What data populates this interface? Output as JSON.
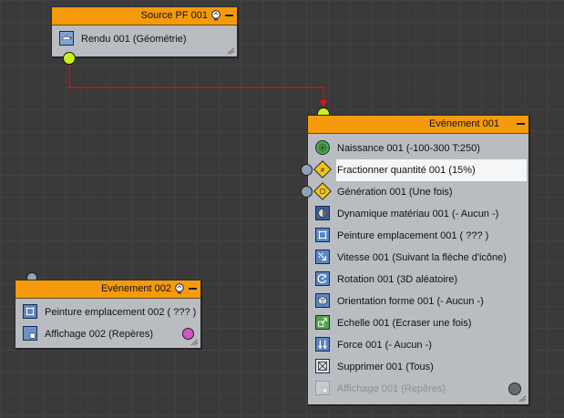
{
  "source_node": {
    "title": "Source PF 001",
    "items": [
      {
        "label": "Rendu 001 (Géométrie)",
        "icon": "teapot-icon"
      }
    ]
  },
  "event_002": {
    "title": "Evénement 002",
    "items": [
      {
        "label": "Peinture emplacement 002 ( ??? )",
        "icon": "position-icon"
      },
      {
        "label": "Affichage 002 (Repères)",
        "icon": "display-icon"
      }
    ]
  },
  "event_001": {
    "title": "Evénement 001",
    "items": [
      {
        "label": "Naissance 001 (-100-300 T:250)",
        "icon": "birth-icon"
      },
      {
        "label": "Fractionner quantité 001 (15%)",
        "icon": "split-amount-icon"
      },
      {
        "label": "Génération 001 (Une fois)",
        "icon": "spawn-icon"
      },
      {
        "label": "Dynamique matériau 001 (- Aucun -)",
        "icon": "material-icon"
      },
      {
        "label": "Peinture emplacement 001 ( ??? )",
        "icon": "position-icon"
      },
      {
        "label": "Vitesse 001 (Suivant la flèche d'icône)",
        "icon": "speed-icon"
      },
      {
        "label": "Rotation 001 (3D aléatoire)",
        "icon": "rotation-icon"
      },
      {
        "label": "Orientation forme 001 (- Aucun -)",
        "icon": "shape-facing-icon"
      },
      {
        "label": "Echelle 001 (Ecraser une fois)",
        "icon": "scale-icon"
      },
      {
        "label": "Force 001 (- Aucun -)",
        "icon": "force-icon"
      },
      {
        "label": "Supprimer 001 (Tous)",
        "icon": "delete-icon"
      },
      {
        "label": "Affichage 001 (Repères)",
        "icon": "display-icon"
      }
    ]
  },
  "colors": {
    "header": "#f59a0b",
    "body": "#b9bcc1",
    "wire": "#e0101a",
    "socket_green": "#c9f21a",
    "socket_pink": "#d455c2",
    "selected_row": "#f4f6f8"
  }
}
